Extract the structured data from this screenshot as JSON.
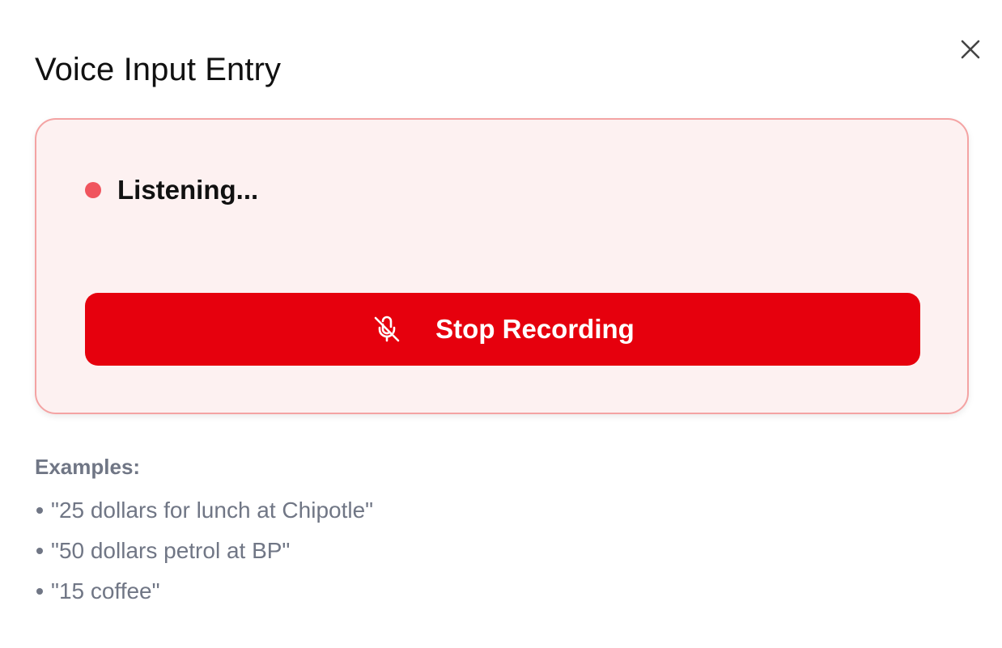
{
  "dialog": {
    "title": "Voice Input Entry",
    "close_icon": "close-icon"
  },
  "recording": {
    "status_text": "Listening...",
    "status_dot_color": "#f0555e",
    "panel_background": "#fdf1f1",
    "panel_border_color": "#f4a3a3",
    "stop_button_label": "Stop Recording",
    "stop_button_color": "#e6000d",
    "stop_button_icon": "mic-off-icon"
  },
  "examples": {
    "heading": "Examples:",
    "items": [
      "\"25 dollars for lunch at Chipotle\"",
      "\"50 dollars petrol at BP\"",
      "\"15 coffee\""
    ],
    "text_color": "#707685"
  }
}
